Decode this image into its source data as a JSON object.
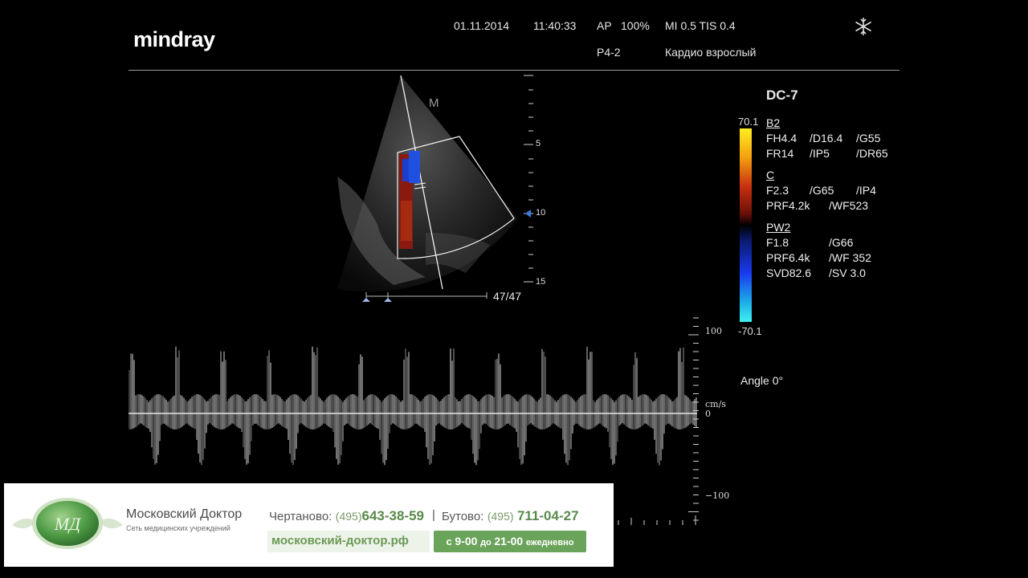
{
  "header": {
    "brand": "mindray",
    "date": "01.11.2014",
    "time": "11:40:33",
    "ap": "AP",
    "ap_value": "100%",
    "mi_tis": "MI 0.5 TIS 0.4",
    "probe": "P4-2",
    "preset": "Кардио взрослый",
    "freeze_icon": "snowflake-icon"
  },
  "image_area": {
    "orientation_mark": "M",
    "depth_ticks": [
      "5",
      "10",
      "15"
    ],
    "frame_counter": "47/47"
  },
  "color_scale": {
    "max": "70.1",
    "min": "-70.1"
  },
  "params": {
    "model": "DC-7",
    "b_mode": {
      "title": "B2",
      "rows": [
        [
          "FH4.4",
          "/D16.4",
          "/G55"
        ],
        [
          "FR14",
          "/IP5",
          "/DR65"
        ]
      ]
    },
    "c_mode": {
      "title": "C",
      "rows": [
        [
          "F2.3",
          "/G65",
          "/IP4"
        ],
        [
          "PRF4.2k",
          "/WF523"
        ]
      ]
    },
    "pw_mode": {
      "title": "PW2",
      "rows": [
        [
          "F1.8",
          "/G66"
        ],
        [
          "PRF6.4k",
          "/WF 352"
        ],
        [
          "SVD82.6",
          "/SV 3.0"
        ]
      ]
    },
    "angle": "Angle 0°"
  },
  "doppler": {
    "unit": "cm/s",
    "ticks": [
      "100",
      "0",
      "−100"
    ]
  },
  "banner": {
    "clinic_name": "Московский Доктор",
    "clinic_sub": "Сеть медицинских учреждений",
    "branch1_label": "Чертаново:",
    "branch1_code": "(495)",
    "branch1_number": "643-38-59",
    "separator": "|",
    "branch2_label": "Бутово:",
    "branch2_code": "(495)",
    "branch2_number": "711-04-27",
    "website": "московский-доктор.рф",
    "hours_from_prefix": "с",
    "hours_from": "9-00",
    "hours_to_prefix": "до",
    "hours_to": "21-00",
    "hours_suffix": "ежедневно",
    "accent": "#6aa35a"
  }
}
